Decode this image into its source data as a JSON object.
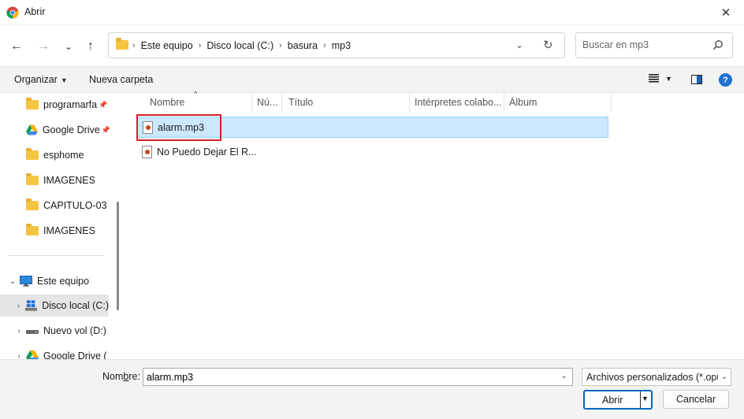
{
  "window": {
    "title": "Abrir",
    "close_glyph": "✕"
  },
  "nav": {
    "back_glyph": "←",
    "forward_glyph": "→",
    "recent_glyph": "⌄",
    "up_glyph": "↑"
  },
  "address": {
    "crumbs": [
      "Este equipo",
      "Disco local (C:)",
      "basura",
      "mp3"
    ],
    "separator": "›",
    "dropdown_glyph": "⌄",
    "refresh_glyph": "↻"
  },
  "search": {
    "placeholder": "Buscar en mp3"
  },
  "toolbar": {
    "organize": "Organizar",
    "organize_caret": "▼",
    "new_folder": "Nueva carpeta",
    "view_caret": "▼"
  },
  "sidebar": {
    "items": [
      {
        "label": "programarfa",
        "icon": "folder-icon",
        "pinned": true,
        "pin_glyph": "📌"
      },
      {
        "label": "Google Drive",
        "icon": "google-drive-icon",
        "pinned": true,
        "pin_glyph": "📌"
      },
      {
        "label": "esphome",
        "icon": "folder-icon"
      },
      {
        "label": "IMAGENES",
        "icon": "folder-icon"
      },
      {
        "label": "CAPITULO-03",
        "icon": "folder-icon"
      },
      {
        "label": "IMAGENES",
        "icon": "folder-icon"
      },
      {
        "label": "Este equipo",
        "icon": "computer-icon",
        "chevron": "⌄"
      },
      {
        "label": "Disco local (C:)",
        "icon": "windows-drive-icon",
        "chevron": "›",
        "selected": true
      },
      {
        "label": "Nuevo vol (D:)",
        "icon": "drive-icon",
        "chevron": "›"
      },
      {
        "label": "Google Drive (",
        "icon": "google-drive-icon",
        "chevron": "›"
      }
    ]
  },
  "columns": [
    "Nombre",
    "Nú...",
    "Título",
    "Intérpretes colabo...",
    "Álbum"
  ],
  "sort_glyph": "^",
  "files": [
    {
      "name": "alarm.mp3",
      "selected": true
    },
    {
      "name": "No Puedo Dejar El R..."
    }
  ],
  "bottom": {
    "filename_label_pre": "Nom",
    "filename_label_ul": "b",
    "filename_label_post": "re:",
    "filename_value": "alarm.mp3",
    "filetype": "Archivos personalizados (*.opus",
    "dropdown_glyph": "⌄",
    "open_label": "Abrir",
    "open_arrow": "▼",
    "cancel_label": "Cancelar"
  },
  "colors": {
    "accent": "#0067c0",
    "selection": "#cce8ff",
    "highlight_box": "#d92027"
  }
}
